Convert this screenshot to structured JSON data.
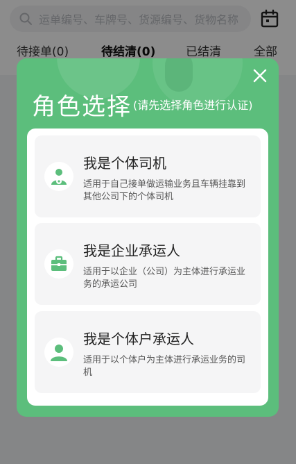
{
  "search": {
    "placeholder": "运单编号、车牌号、货源编号、货物名称"
  },
  "toolbar": {
    "calendar_icon": "calendar-icon"
  },
  "tabs": [
    {
      "label": "待接单(0)"
    },
    {
      "label": "待结清(0)"
    },
    {
      "label": "已结清"
    },
    {
      "label": "全部"
    }
  ],
  "modal": {
    "title": "角色选择",
    "subtitle": "(请先选择角色进行认证)",
    "close_icon": "close-icon",
    "options": [
      {
        "icon": "driver-icon",
        "title": "我是个体司机",
        "desc": "适用于自己接单做运输业务且车辆挂靠到其他公司下的个体司机"
      },
      {
        "icon": "briefcase-icon",
        "title": "我是企业承运人",
        "desc": "适用于以企业（公司）为主体进行承运业务的承运公司"
      },
      {
        "icon": "person-icon",
        "title": "我是个体户承运人",
        "desc": "适用于以个体户为主体进行承运业务的司机"
      }
    ]
  },
  "colors": {
    "accent": "#5cbe7c",
    "overlay": "rgba(0,0,0,0.45)"
  }
}
